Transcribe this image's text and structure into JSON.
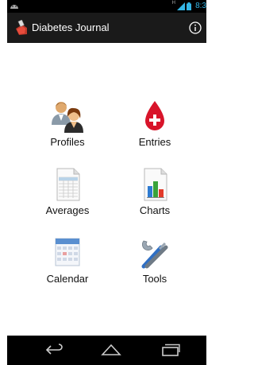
{
  "status": {
    "time": "8:3",
    "network": "H"
  },
  "header": {
    "title": "Diabetes Journal"
  },
  "menu": [
    {
      "label": "Profiles",
      "icon": "profiles-icon"
    },
    {
      "label": "Entries",
      "icon": "blood-drop-icon"
    },
    {
      "label": "Averages",
      "icon": "spreadsheet-icon"
    },
    {
      "label": "Charts",
      "icon": "bar-chart-icon"
    },
    {
      "label": "Calendar",
      "icon": "calendar-icon"
    },
    {
      "label": "Tools",
      "icon": "tools-icon"
    }
  ],
  "colors": {
    "accent": "#33b5e5",
    "bar": "#1a1a1a",
    "drop": "#d8142a"
  }
}
